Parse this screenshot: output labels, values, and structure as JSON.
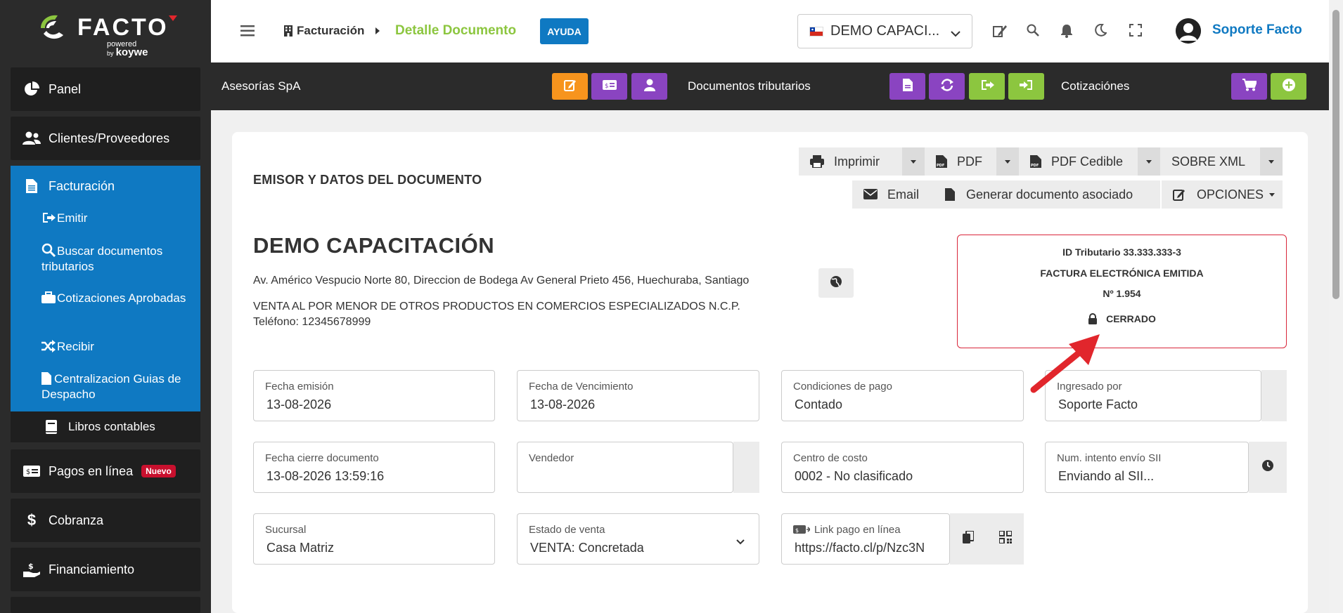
{
  "sidebar": {
    "logo": {
      "name": "FACTO",
      "powered": "powered",
      "by": "by",
      "brand": "koywe"
    },
    "items": [
      {
        "label": "Panel",
        "icon": "pie-chart-icon"
      },
      {
        "label": "Clientes/Proveedores",
        "icon": "users-icon"
      },
      {
        "label": "Facturación",
        "icon": "document-icon"
      },
      {
        "label": "Pagos en línea",
        "icon": "payment-card-icon",
        "badge": "Nuevo"
      },
      {
        "label": "Cobranza",
        "icon": "dollar-icon"
      },
      {
        "label": "Financiamiento",
        "icon": "hand-coin-icon"
      }
    ],
    "sub_items": [
      {
        "label": "Emitir",
        "icon": "sign-out-icon"
      },
      {
        "label": "Buscar documentos tributarios",
        "icon": "search-icon"
      },
      {
        "label": "Cotizaciones Aprobadas",
        "icon": "briefcase-icon"
      },
      {
        "label": "Recibir",
        "icon": "shuffle-icon"
      },
      {
        "label": "Centralizacion Guias de Despacho",
        "icon": "file-icon"
      }
    ],
    "libros": {
      "label": "Libros contables",
      "icon": "book-icon"
    }
  },
  "header": {
    "breadcrumb_parent": "Facturación",
    "breadcrumb_current": "Detalle Documento",
    "help_label": "AYUDA",
    "company_selector": "DEMO CAPACI...",
    "user_name": "Soporte Facto"
  },
  "subbar": {
    "company": "Asesorías SpA",
    "docs_label": "Documentos tributarios",
    "quotes_label": "Cotizaciónes"
  },
  "main": {
    "section_title": "EMISOR Y DATOS DEL DOCUMENTO",
    "buttons": {
      "print": "Imprimir",
      "pdf": "PDF",
      "pdf_cedible": "PDF Cedible",
      "xml": "SOBRE XML",
      "email": "Email",
      "generate": "Generar documento asociado",
      "options": "OPCIONES"
    },
    "company_name": "DEMO CAPACITACIÓN",
    "address": "Av. Américo Vespucio Norte 80, Direccion de Bodega Av General Prieto 456, Huechuraba, Santiago",
    "activity": "VENTA AL POR MENOR DE OTROS PRODUCTOS EN COMERCIOS ESPECIALIZADOS N.C.P.",
    "phone": "Teléfono: 12345678999",
    "doc_box": {
      "tax_id": "ID Tributario 33.333.333-3",
      "doc_type": "FACTURA ELECTRÓNICA EMITIDA",
      "number": "Nº 1.954",
      "status": "CERRADO"
    },
    "fields": {
      "fecha_emision": {
        "label": "Fecha emisión",
        "value": "13-08-2026"
      },
      "fecha_vencimiento": {
        "label": "Fecha de Vencimiento",
        "value": "13-08-2026"
      },
      "condiciones_pago": {
        "label": "Condiciones de pago",
        "value": "Contado"
      },
      "ingresado_por": {
        "label": "Ingresado por",
        "value": "Soporte Facto"
      },
      "fecha_cierre": {
        "label": "Fecha cierre documento",
        "value": "13-08-2026 13:59:16"
      },
      "vendedor": {
        "label": "Vendedor",
        "value": ""
      },
      "centro_costo": {
        "label": "Centro de costo",
        "value": "0002 - No clasificado"
      },
      "num_intento": {
        "label": "Num. intento envío SII",
        "value": "Enviando al SII..."
      },
      "sucursal": {
        "label": "Sucursal",
        "value": "Casa Matriz"
      },
      "estado_venta": {
        "label": "Estado de venta",
        "value": "VENTA: Concretada"
      },
      "link_pago": {
        "label": "Link pago en línea",
        "value": "https://facto.cl/p/Nzc3N"
      }
    }
  },
  "colors": {
    "blue": "#0f79c2",
    "green": "#8cc63f",
    "purple": "#8a44c1",
    "orange": "#f7941d",
    "red": "#d9263a"
  }
}
